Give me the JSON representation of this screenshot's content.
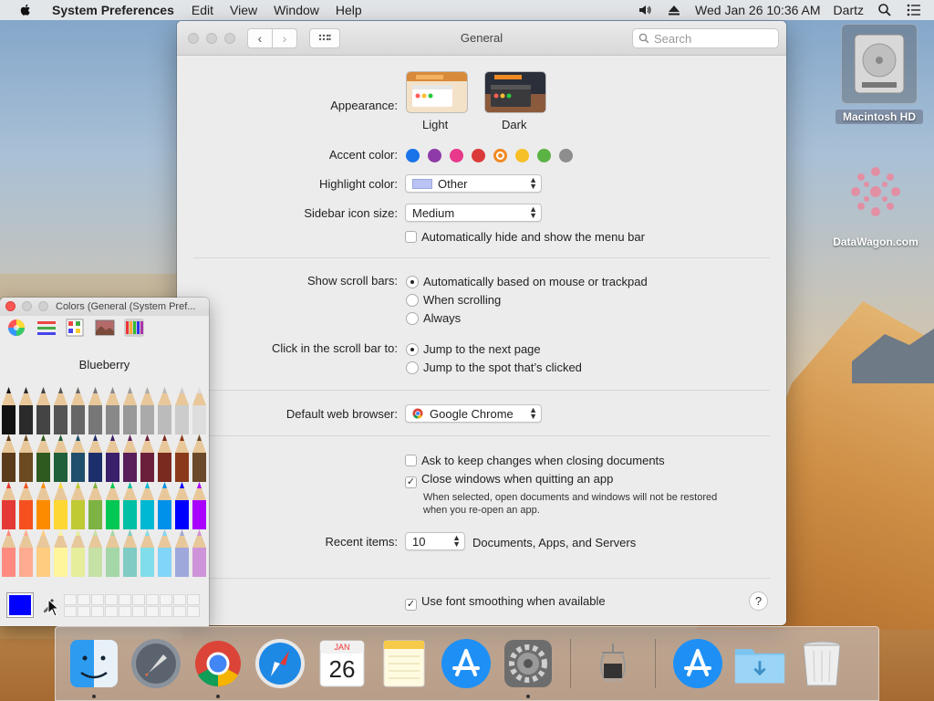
{
  "menubar": {
    "app_name": "System Preferences",
    "menus": [
      "Edit",
      "View",
      "Window",
      "Help"
    ],
    "datetime": "Wed Jan 26  10:36 AM",
    "user": "Dartz"
  },
  "desktop": {
    "hd_label": "Macintosh HD",
    "watermark_label": "DataWagon.com"
  },
  "window": {
    "title": "General",
    "search_placeholder": "Search"
  },
  "general": {
    "appearance_label": "Appearance:",
    "appearance_light": "Light",
    "appearance_dark": "Dark",
    "accent_label": "Accent color:",
    "accent_colors": [
      "#1a73e8",
      "#8e3aa8",
      "#e8398c",
      "#dc3a3a",
      "#f08a24",
      "#f6c026",
      "#5bb344",
      "#8d8d8d"
    ],
    "highlight_label": "Highlight color:",
    "highlight_value": "Other",
    "highlight_swatch": "#b9c4f5",
    "sidebar_label": "Sidebar icon size:",
    "sidebar_value": "Medium",
    "menubar_hide": "Automatically hide and show the menu bar",
    "scroll_label": "Show scroll bars:",
    "scroll_opt1": "Automatically based on mouse or trackpad",
    "scroll_opt2": "When scrolling",
    "scroll_opt3": "Always",
    "click_label": "Click in the scroll bar to:",
    "click_opt1": "Jump to the next page",
    "click_opt2": "Jump to the spot that’s clicked",
    "browser_label": "Default web browser:",
    "browser_value": "Google Chrome",
    "ask_keep": "Ask to keep changes when closing documents",
    "close_windows": "Close windows when quitting an app",
    "close_note_1": "When selected, open documents and windows will not be restored",
    "close_note_2": "when you re-open an app.",
    "recent_label": "Recent items:",
    "recent_value": "10",
    "recent_suffix": "Documents, Apps, and Servers",
    "font_smoothing": "Use font smoothing when available",
    "help": "?"
  },
  "colors_panel": {
    "title": "Colors (General (System Pref...",
    "selected_name": "Blueberry",
    "selected_color": "#0000ff"
  },
  "dock": {
    "calendar_month": "JAN",
    "calendar_day": "26"
  }
}
